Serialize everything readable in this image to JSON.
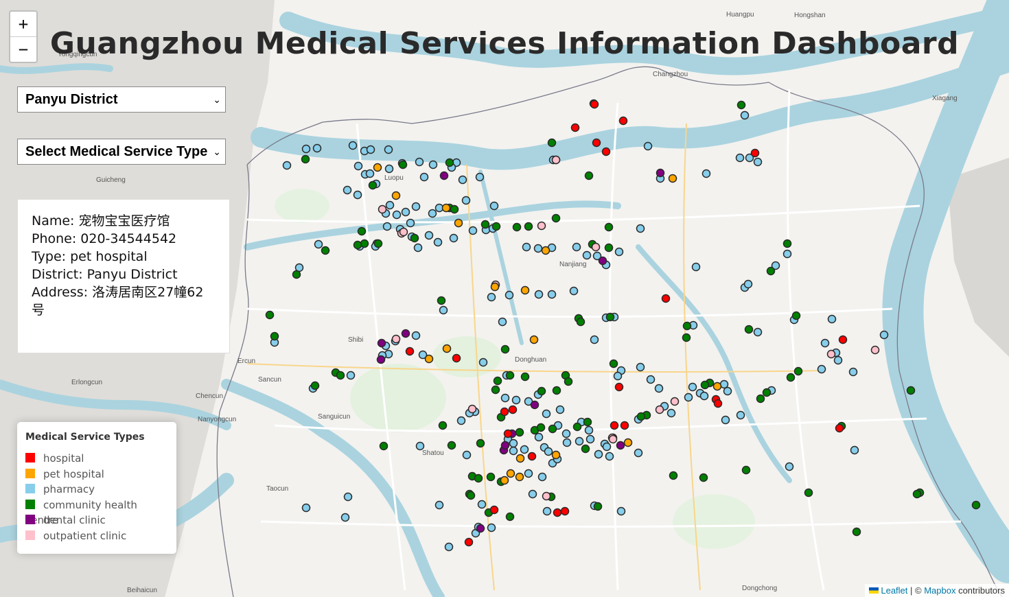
{
  "title": "Guangzhou Medical Services Information Dashboard",
  "zoom": {
    "in_label": "+",
    "out_label": "−"
  },
  "filters": {
    "district_selected": "Panyu District",
    "service_selected": "Select Medical Service Type",
    "arrow": "⌄"
  },
  "info": {
    "name": "Name: 宠物宝宝医疗馆",
    "phone": "Phone: 020-34544542",
    "type": "Type: pet hospital",
    "district": "District: Panyu District",
    "address": "Address: 洛涛居南区27幢62号"
  },
  "legend": {
    "title": "Medical Service Types",
    "items": [
      {
        "label": "hospital",
        "color": "#ff0000"
      },
      {
        "label": "pet hospital",
        "color": "#ffa500"
      },
      {
        "label": "pharmacy",
        "color": "#87ceeb"
      },
      {
        "label": "community health centre",
        "color": "#008000"
      },
      {
        "label": "dental clinic",
        "color": "#800080"
      },
      {
        "label": "outpatient clinic",
        "color": "#ffc0cb"
      }
    ]
  },
  "attribution": {
    "leaflet": "Leaflet",
    "sep": " | © ",
    "mapbox": "Mapbox",
    "suffix": " contributors"
  },
  "map_labels": [
    {
      "text": "Guicheng"
    },
    {
      "text": "Chencun"
    },
    {
      "text": "Nanjiang"
    },
    {
      "text": "Shibi"
    },
    {
      "text": "Donghuan"
    },
    {
      "text": "Shatou"
    },
    {
      "text": "Luopu"
    },
    {
      "text": "Xiagang"
    },
    {
      "text": "Huangpu"
    },
    {
      "text": "Hongshan"
    },
    {
      "text": "Changzhou"
    },
    {
      "text": "Dongchong"
    },
    {
      "text": "Yongqingcun"
    },
    {
      "text": "Taocun"
    },
    {
      "text": "Beihaicun"
    },
    {
      "text": "Sancun"
    },
    {
      "text": "Ercun"
    },
    {
      "text": "Sanguicun"
    },
    {
      "text": "Nanyongcun"
    },
    {
      "text": "Erlongcun"
    }
  ],
  "markers_by_type": {
    "hospital": [
      [
        866,
        152
      ],
      [
        838,
        186
      ],
      [
        908,
        176
      ],
      [
        869,
        208
      ],
      [
        883,
        221
      ],
      [
        1100,
        223
      ],
      [
        970,
        435
      ],
      [
        665,
        522
      ],
      [
        597,
        512
      ],
      [
        1228,
        495
      ],
      [
        902,
        564
      ],
      [
        1043,
        582
      ],
      [
        1046,
        588
      ],
      [
        910,
        620
      ],
      [
        1223,
        624
      ],
      [
        735,
        600
      ],
      [
        747,
        597
      ],
      [
        740,
        632
      ],
      [
        775,
        665
      ],
      [
        720,
        743
      ],
      [
        823,
        745
      ],
      [
        812,
        747
      ],
      [
        683,
        790
      ],
      [
        895,
        620
      ]
    ],
    "pet_hospital": [
      [
        550,
        244
      ],
      [
        980,
        260
      ],
      [
        577,
        285
      ],
      [
        650,
        303
      ],
      [
        668,
        325
      ],
      [
        721,
        418
      ],
      [
        765,
        423
      ],
      [
        778,
        495
      ],
      [
        651,
        508
      ],
      [
        625,
        523
      ],
      [
        1045,
        563
      ],
      [
        810,
        663
      ],
      [
        758,
        668
      ],
      [
        744,
        690
      ],
      [
        757,
        695
      ],
      [
        735,
        700
      ],
      [
        795,
        365
      ],
      [
        915,
        645
      ]
    ],
    "pharmacy": [
      [
        1085,
        168
      ],
      [
        418,
        241
      ],
      [
        446,
        217
      ],
      [
        462,
        216
      ],
      [
        514,
        212
      ],
      [
        531,
        220
      ],
      [
        540,
        218
      ],
      [
        566,
        218
      ],
      [
        522,
        242
      ],
      [
        532,
        254
      ],
      [
        548,
        268
      ],
      [
        506,
        277
      ],
      [
        521,
        284
      ],
      [
        539,
        253
      ],
      [
        567,
        246
      ],
      [
        586,
        238
      ],
      [
        611,
        236
      ],
      [
        631,
        240
      ],
      [
        665,
        237
      ],
      [
        674,
        262
      ],
      [
        699,
        258
      ],
      [
        618,
        258
      ],
      [
        658,
        244
      ],
      [
        944,
        213
      ],
      [
        806,
        233
      ],
      [
        1029,
        253
      ],
      [
        1078,
        230
      ],
      [
        1104,
        236
      ],
      [
        1092,
        230
      ],
      [
        962,
        260
      ],
      [
        568,
        299
      ],
      [
        562,
        311
      ],
      [
        578,
        313
      ],
      [
        591,
        309
      ],
      [
        606,
        301
      ],
      [
        598,
        325
      ],
      [
        583,
        334
      ],
      [
        564,
        330
      ],
      [
        600,
        345
      ],
      [
        630,
        311
      ],
      [
        640,
        303
      ],
      [
        679,
        292
      ],
      [
        720,
        300
      ],
      [
        708,
        335
      ],
      [
        689,
        336
      ],
      [
        718,
        333
      ],
      [
        625,
        343
      ],
      [
        638,
        353
      ],
      [
        661,
        347
      ],
      [
        609,
        361
      ],
      [
        549,
        355
      ],
      [
        524,
        359
      ],
      [
        547,
        359
      ],
      [
        464,
        356
      ],
      [
        767,
        360
      ],
      [
        784,
        362
      ],
      [
        804,
        361
      ],
      [
        840,
        360
      ],
      [
        855,
        372
      ],
      [
        870,
        373
      ],
      [
        883,
        386
      ],
      [
        902,
        367
      ],
      [
        836,
        424
      ],
      [
        933,
        333
      ],
      [
        1014,
        389
      ],
      [
        1085,
        419
      ],
      [
        1147,
        370
      ],
      [
        1130,
        387
      ],
      [
        436,
        390
      ],
      [
        716,
        433
      ],
      [
        742,
        430
      ],
      [
        785,
        429
      ],
      [
        804,
        429
      ],
      [
        646,
        452
      ],
      [
        732,
        469
      ],
      [
        866,
        495
      ],
      [
        883,
        463
      ],
      [
        895,
        462
      ],
      [
        1010,
        474
      ],
      [
        1104,
        484
      ],
      [
        1157,
        466
      ],
      [
        1212,
        465
      ],
      [
        1288,
        488
      ],
      [
        1197,
        538
      ],
      [
        1218,
        514
      ],
      [
        1221,
        525
      ],
      [
        1202,
        500
      ],
      [
        562,
        504
      ],
      [
        566,
        516
      ],
      [
        557,
        518
      ],
      [
        576,
        497
      ],
      [
        606,
        489
      ],
      [
        616,
        517
      ],
      [
        704,
        528
      ],
      [
        738,
        547
      ],
      [
        736,
        580
      ],
      [
        752,
        583
      ],
      [
        770,
        585
      ],
      [
        784,
        575
      ],
      [
        796,
        603
      ],
      [
        816,
        597
      ],
      [
        813,
        620
      ],
      [
        825,
        632
      ],
      [
        847,
        615
      ],
      [
        858,
        627
      ],
      [
        860,
        640
      ],
      [
        881,
        647
      ],
      [
        884,
        651
      ],
      [
        893,
        638
      ],
      [
        930,
        611
      ],
      [
        933,
        535
      ],
      [
        948,
        553
      ],
      [
        905,
        540
      ],
      [
        900,
        548
      ],
      [
        960,
        566
      ],
      [
        968,
        592
      ],
      [
        978,
        602
      ],
      [
        1003,
        579
      ],
      [
        1009,
        564
      ],
      [
        1020,
        573
      ],
      [
        1026,
        577
      ],
      [
        1060,
        570
      ],
      [
        1079,
        605
      ],
      [
        1057,
        612
      ],
      [
        1055,
        560
      ],
      [
        1124,
        569
      ],
      [
        1150,
        680
      ],
      [
        1245,
        656
      ],
      [
        1243,
        542
      ],
      [
        692,
        600
      ],
      [
        684,
        602
      ],
      [
        672,
        613
      ],
      [
        612,
        650
      ],
      [
        680,
        663
      ],
      [
        740,
        640
      ],
      [
        748,
        657
      ],
      [
        748,
        646
      ],
      [
        764,
        655
      ],
      [
        785,
        637
      ],
      [
        793,
        652
      ],
      [
        799,
        658
      ],
      [
        805,
        675
      ],
      [
        812,
        669
      ],
      [
        790,
        695
      ],
      [
        770,
        690
      ],
      [
        776,
        720
      ],
      [
        797,
        745
      ],
      [
        826,
        645
      ],
      [
        844,
        643
      ],
      [
        872,
        662
      ],
      [
        888,
        665
      ],
      [
        930,
        660
      ],
      [
        905,
        745
      ],
      [
        866,
        737
      ],
      [
        640,
        736
      ],
      [
        693,
        777
      ],
      [
        697,
        768
      ],
      [
        716,
        769
      ],
      [
        654,
        797
      ],
      [
        702,
        735
      ],
      [
        507,
        724
      ],
      [
        503,
        754
      ],
      [
        446,
        740
      ],
      [
        511,
        547
      ],
      [
        456,
        566
      ],
      [
        400,
        499
      ],
      [
        1090,
        414
      ]
    ],
    "community_health_centre": [
      [
        1080,
        153
      ],
      [
        804,
        208
      ],
      [
        858,
        256
      ],
      [
        445,
        232
      ],
      [
        587,
        240
      ],
      [
        655,
        237
      ],
      [
        655,
        303
      ],
      [
        662,
        305
      ],
      [
        707,
        327
      ],
      [
        723,
        330
      ],
      [
        753,
        331
      ],
      [
        770,
        330
      ],
      [
        810,
        318
      ],
      [
        887,
        331
      ],
      [
        863,
        356
      ],
      [
        887,
        361
      ],
      [
        604,
        347
      ],
      [
        551,
        355
      ],
      [
        531,
        355
      ],
      [
        521,
        357
      ],
      [
        474,
        365
      ],
      [
        432,
        400
      ],
      [
        1123,
        395
      ],
      [
        1147,
        355
      ],
      [
        643,
        438
      ],
      [
        393,
        459
      ],
      [
        400,
        490
      ],
      [
        843,
        464
      ],
      [
        846,
        469
      ],
      [
        889,
        462
      ],
      [
        1001,
        475
      ],
      [
        1000,
        492
      ],
      [
        1091,
        480
      ],
      [
        1160,
        460
      ],
      [
        736,
        509
      ],
      [
        743,
        547
      ],
      [
        765,
        549
      ],
      [
        824,
        547
      ],
      [
        828,
        556
      ],
      [
        894,
        530
      ],
      [
        722,
        568
      ],
      [
        725,
        555
      ],
      [
        789,
        570
      ],
      [
        811,
        569
      ],
      [
        730,
        608
      ],
      [
        757,
        630
      ],
      [
        779,
        627
      ],
      [
        788,
        623
      ],
      [
        805,
        625
      ],
      [
        856,
        615
      ],
      [
        841,
        622
      ],
      [
        853,
        654
      ],
      [
        942,
        605
      ],
      [
        934,
        607
      ],
      [
        1034,
        558
      ],
      [
        1027,
        561
      ],
      [
        1152,
        550
      ],
      [
        1163,
        541
      ],
      [
        1108,
        581
      ],
      [
        1117,
        572
      ],
      [
        1226,
        621
      ],
      [
        1327,
        569
      ],
      [
        1340,
        718
      ],
      [
        1336,
        720
      ],
      [
        981,
        693
      ],
      [
        1025,
        696
      ],
      [
        1087,
        685
      ],
      [
        1178,
        718
      ],
      [
        1248,
        775
      ],
      [
        1422,
        736
      ],
      [
        559,
        650
      ],
      [
        645,
        620
      ],
      [
        658,
        649
      ],
      [
        700,
        646
      ],
      [
        688,
        694
      ],
      [
        697,
        697
      ],
      [
        715,
        695
      ],
      [
        730,
        702
      ],
      [
        684,
        720
      ],
      [
        686,
        722
      ],
      [
        712,
        747
      ],
      [
        743,
        753
      ],
      [
        803,
        724
      ],
      [
        871,
        738
      ],
      [
        489,
        543
      ],
      [
        496,
        547
      ],
      [
        459,
        562
      ],
      [
        527,
        337
      ],
      [
        543,
        270
      ]
    ],
    "dental_clinic": [
      [
        647,
        256
      ],
      [
        556,
        500
      ],
      [
        591,
        486
      ],
      [
        555,
        524
      ],
      [
        878,
        380
      ],
      [
        779,
        590
      ],
      [
        746,
        632
      ],
      [
        904,
        649
      ],
      [
        734,
        656
      ],
      [
        736,
        649
      ],
      [
        700,
        770
      ],
      [
        962,
        252
      ]
    ],
    "outpatient_clinic": [
      [
        865,
        151
      ],
      [
        810,
        233
      ],
      [
        789,
        329
      ],
      [
        585,
        340
      ],
      [
        557,
        305
      ],
      [
        588,
        338
      ],
      [
        722,
        415
      ],
      [
        577,
        494
      ],
      [
        868,
        360
      ],
      [
        983,
        585
      ],
      [
        961,
        597
      ],
      [
        1211,
        516
      ],
      [
        1275,
        510
      ],
      [
        892,
        638
      ],
      [
        688,
        596
      ],
      [
        796,
        723
      ],
      [
        893,
        640
      ],
      [
        810,
        233
      ]
    ]
  }
}
